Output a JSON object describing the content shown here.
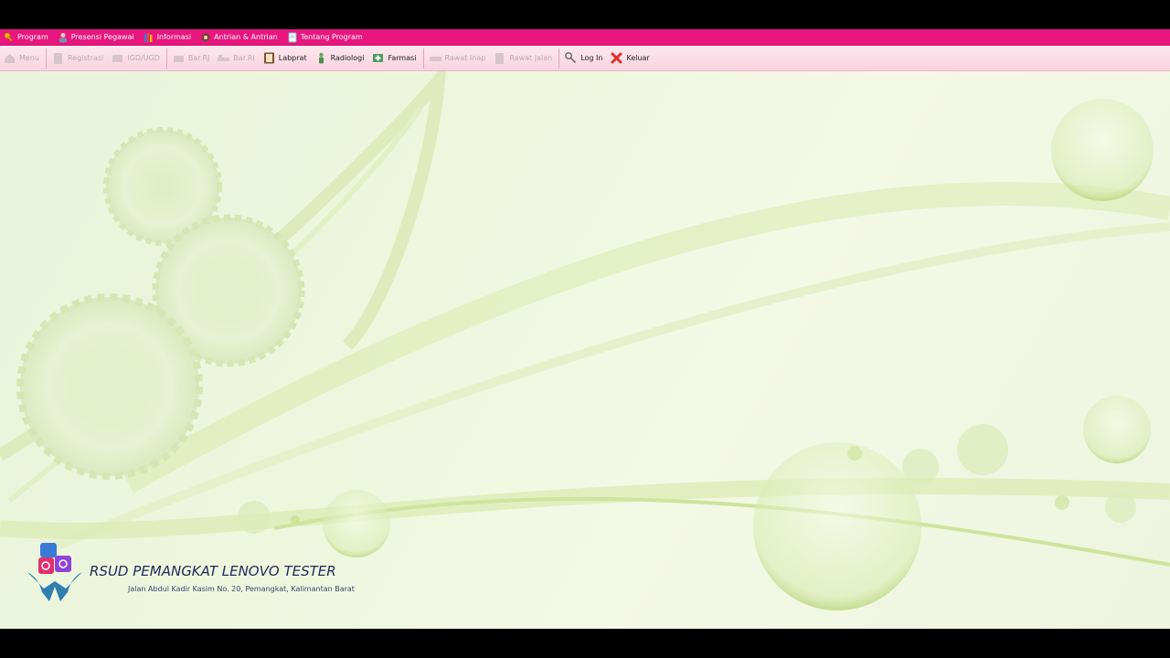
{
  "menubar": {
    "items": [
      {
        "label": "Program",
        "icon": "key-icon"
      },
      {
        "label": "Presensi Pegawai",
        "icon": "person-icon"
      },
      {
        "label": "Informasi",
        "icon": "books-icon"
      },
      {
        "label": "Antrian & Antrian",
        "icon": "gear-people-icon"
      },
      {
        "label": "Tentang Program",
        "icon": "document-icon"
      }
    ]
  },
  "toolbar": {
    "menu": "Menu",
    "registrasi": "Registrasi",
    "igd": "IGD/UGD",
    "bar_rj": "Bar.RJ",
    "bar_ri": "Bar.RI",
    "labprat": "Labprat",
    "radiologi": "Radiologi",
    "farmasi": "Farmasi",
    "rawat_inap": "Rawat Inap",
    "rawat_jalan": "Rawat Jalan",
    "log_in": "Log In",
    "keluar": "Keluar"
  },
  "brand": {
    "title": "RSUD PEMANGKAT LENOVO TESTER",
    "address": "Jalan Abdul Kadir Kasim  No. 20, Pemangkat, Kalimantan Barat"
  },
  "colors": {
    "menubar": "#e8167e",
    "toolbar": "#fde8ef",
    "desktop": "#eef6dd"
  }
}
